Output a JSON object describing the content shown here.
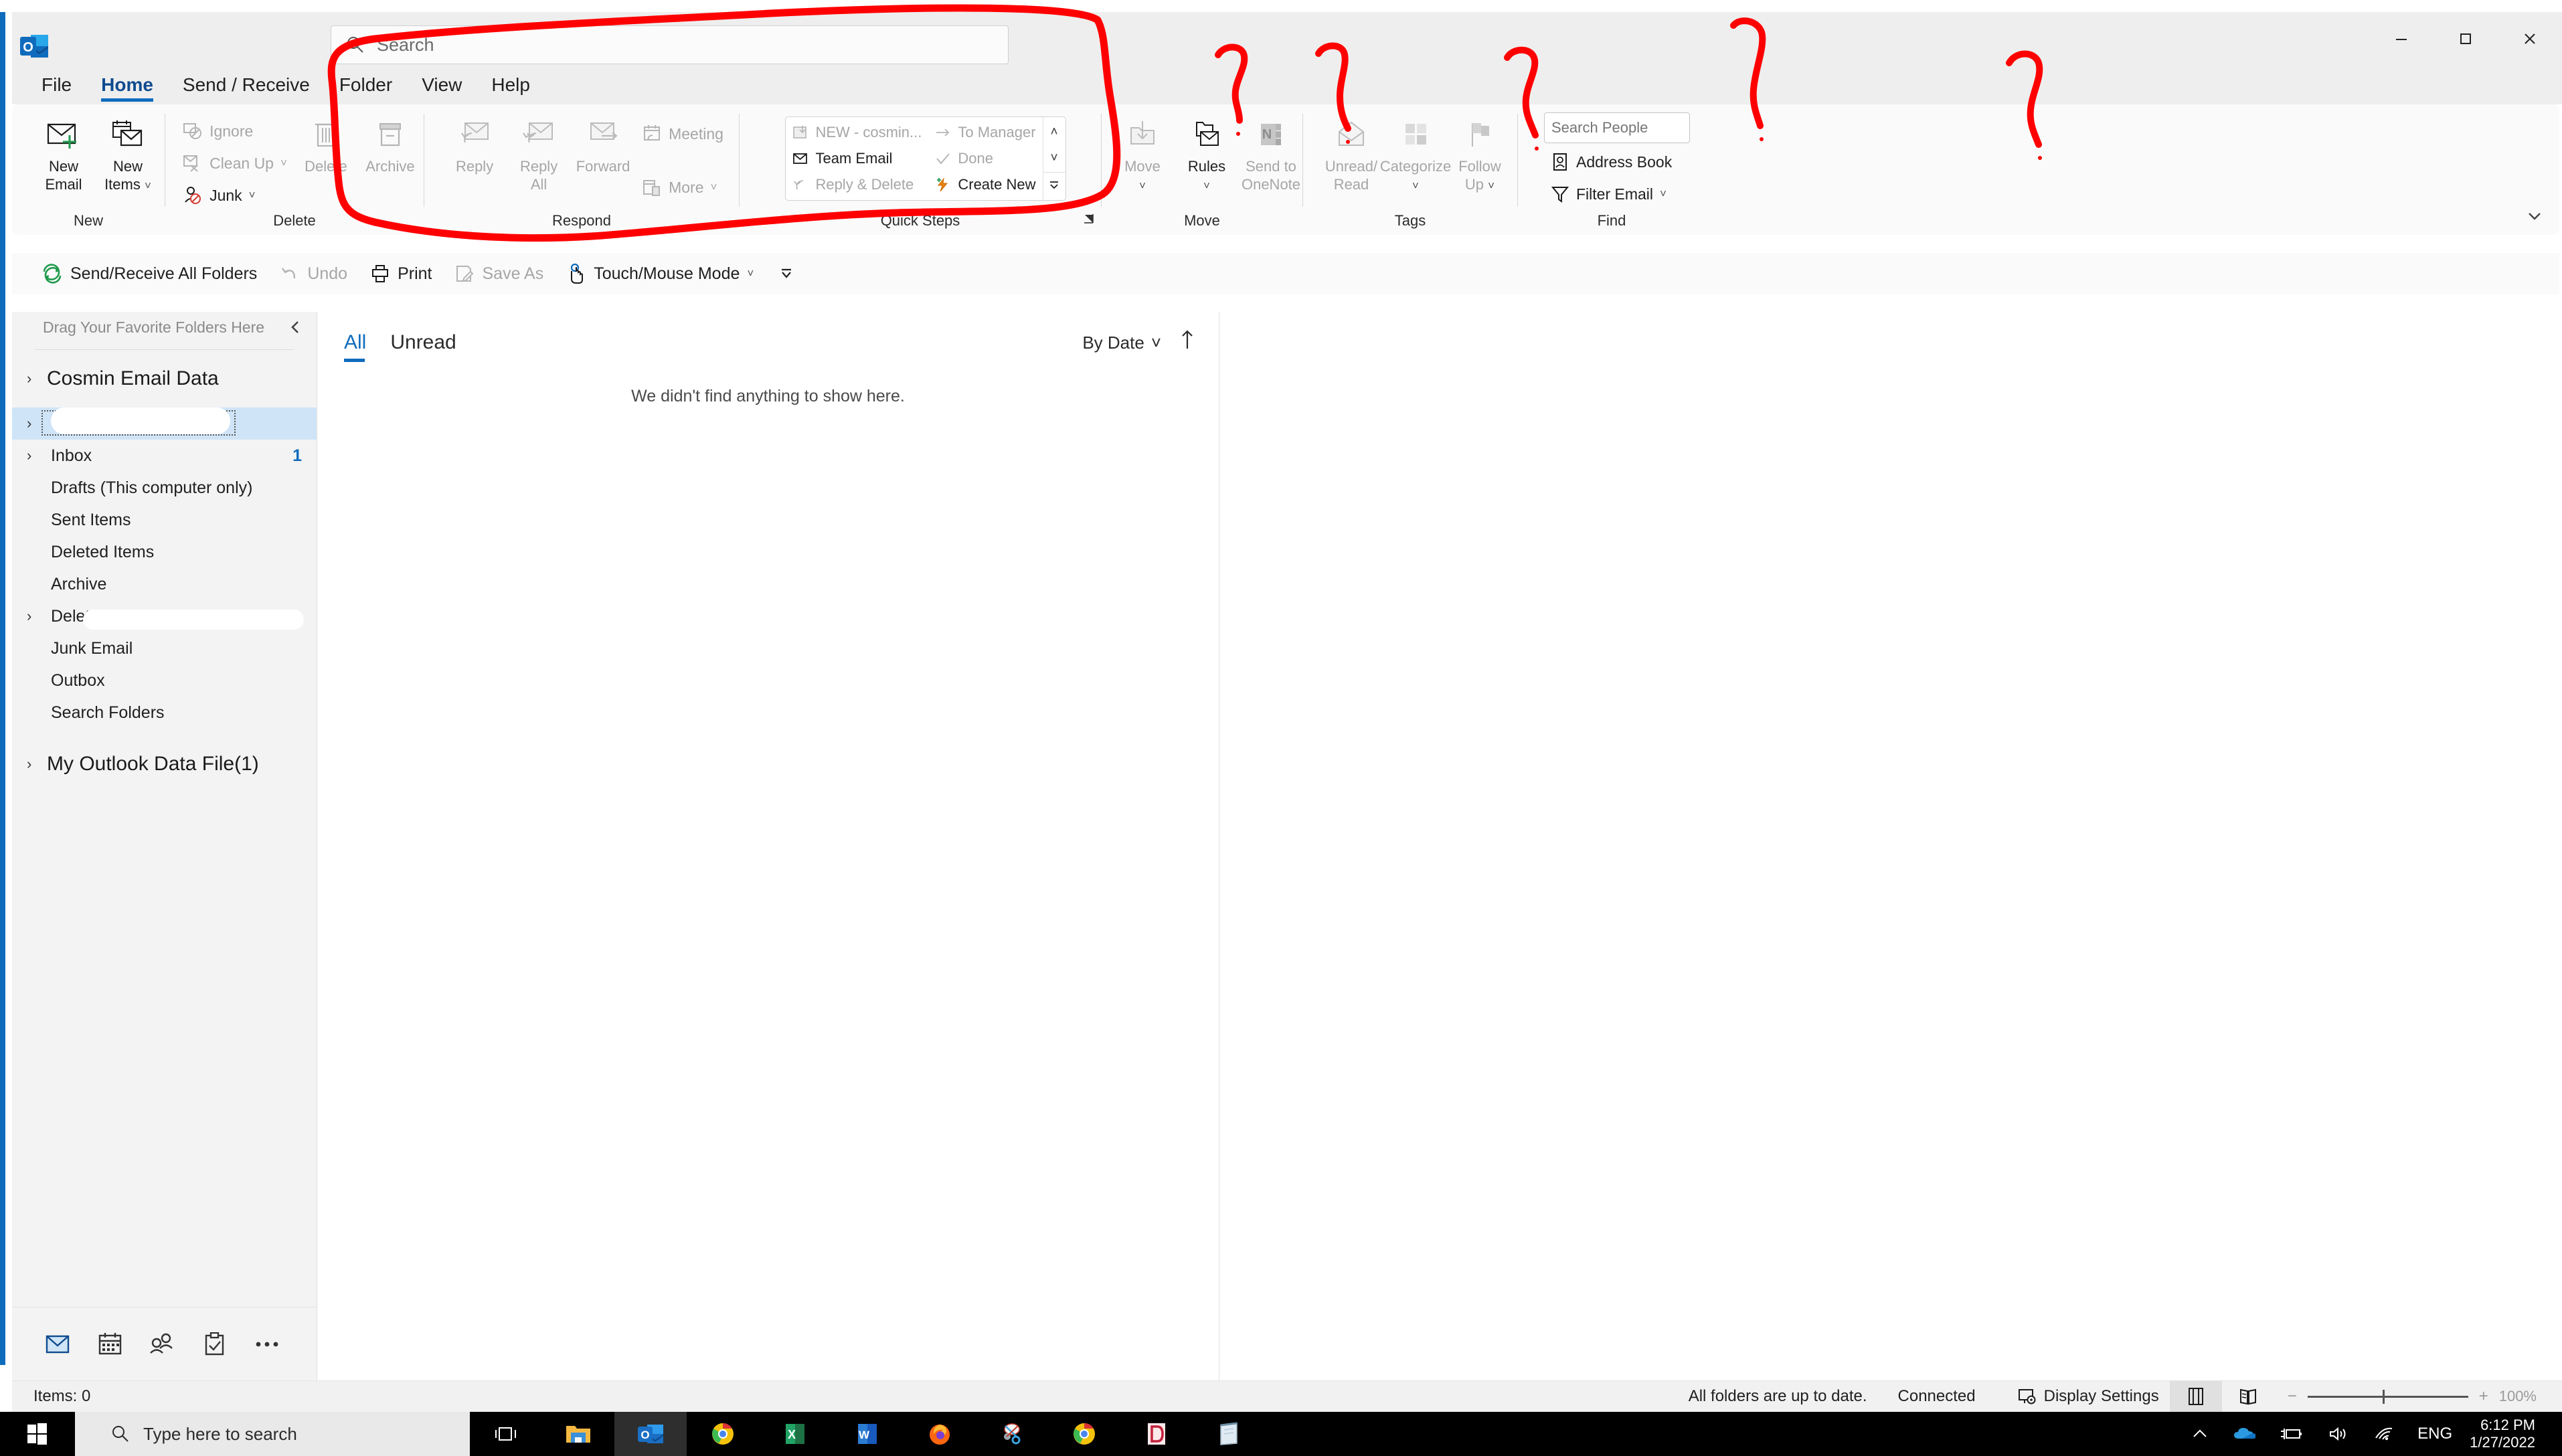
{
  "window": {
    "app_icon": "outlook-icon",
    "minimize": "—",
    "maximize": "□",
    "close": "✕"
  },
  "search": {
    "placeholder": "Search",
    "icon": "search-icon"
  },
  "tabs": [
    {
      "label": "File",
      "active": false
    },
    {
      "label": "Home",
      "active": true
    },
    {
      "label": "Send / Receive",
      "active": false
    },
    {
      "label": "Folder",
      "active": false
    },
    {
      "label": "View",
      "active": false
    },
    {
      "label": "Help",
      "active": false
    }
  ],
  "ribbon": {
    "collapse_icon": "chevron-down-icon",
    "groups": {
      "new": {
        "label": "New",
        "buttons": [
          {
            "label_line1": "New",
            "label_line2": "Email",
            "icon": "new-email-icon",
            "disabled": false
          },
          {
            "label_line1": "New",
            "label_line2": "Items",
            "icon": "new-items-icon",
            "disabled": false,
            "caret": "˅"
          }
        ]
      },
      "delete": {
        "label": "Delete",
        "small": [
          {
            "label": "Ignore",
            "icon": "ignore-icon",
            "disabled": true
          },
          {
            "label": "Clean Up",
            "icon": "cleanup-icon",
            "disabled": true,
            "caret": "˅"
          },
          {
            "label": "Junk",
            "icon": "junk-icon",
            "disabled": false,
            "caret": "˅"
          }
        ],
        "big": [
          {
            "label_line1": "Delete",
            "label_line2": "",
            "icon": "trash-icon",
            "disabled": true
          },
          {
            "label_line1": "Archive",
            "label_line2": "",
            "icon": "archive-icon",
            "disabled": true
          }
        ]
      },
      "respond": {
        "label": "Respond",
        "big": [
          {
            "label_line1": "Reply",
            "label_line2": "",
            "icon": "reply-icon",
            "disabled": true
          },
          {
            "label_line1": "Reply",
            "label_line2": "All",
            "icon": "reply-all-icon",
            "disabled": true
          },
          {
            "label_line1": "Forward",
            "label_line2": "",
            "icon": "forward-icon",
            "disabled": true
          }
        ],
        "small": [
          {
            "label": "Meeting",
            "icon": "meeting-icon",
            "disabled": true
          },
          {
            "label": "More",
            "icon": "more-icon",
            "disabled": true,
            "caret": "˅"
          }
        ]
      },
      "quick_steps": {
        "label": "Quick Steps",
        "dialog_launcher": "dialog-launcher-icon",
        "col1": [
          {
            "label": "NEW - cosmin...",
            "icon": "move-to-folder-icon",
            "disabled": true
          },
          {
            "label": "Team Email",
            "icon": "team-email-icon",
            "disabled": false
          },
          {
            "label": "Reply & Delete",
            "icon": "reply-delete-icon",
            "disabled": true
          }
        ],
        "col2": [
          {
            "label": "To Manager",
            "icon": "to-manager-icon",
            "disabled": true
          },
          {
            "label": "Done",
            "icon": "done-check-icon",
            "disabled": true
          },
          {
            "label": "Create New",
            "icon": "create-new-lightning-icon",
            "disabled": false
          }
        ],
        "scroll": [
          "˄",
          "˅",
          "˅"
        ]
      },
      "move": {
        "label": "Move",
        "buttons": [
          {
            "label_line1": "Move",
            "label_line2": "",
            "icon": "move-folder-icon",
            "disabled": true,
            "caret": "˅"
          },
          {
            "label_line1": "Rules",
            "label_line2": "",
            "icon": "rules-icon",
            "disabled": false,
            "caret": "˅"
          },
          {
            "label_line1": "Send to",
            "label_line2": "OneNote",
            "icon": "onenote-icon",
            "disabled": true
          }
        ]
      },
      "tags": {
        "label": "Tags",
        "buttons": [
          {
            "label_line1": "Unread/",
            "label_line2": "Read",
            "icon": "unread-read-icon",
            "disabled": true
          },
          {
            "label_line1": "Categorize",
            "label_line2": "",
            "icon": "categorize-icon",
            "disabled": true,
            "caret": "˅"
          },
          {
            "label_line1": "Follow",
            "label_line2": "Up",
            "icon": "follow-up-flag-icon",
            "disabled": true,
            "caret": "˅"
          }
        ]
      },
      "find": {
        "label": "Find",
        "people_placeholder": "Search People",
        "items": [
          {
            "label": "Address Book",
            "icon": "address-book-icon",
            "disabled": false
          },
          {
            "label": "Filter Email",
            "icon": "filter-funnel-icon",
            "disabled": false,
            "caret": "˅"
          }
        ]
      }
    }
  },
  "qat": [
    {
      "label": "Send/Receive All Folders",
      "icon": "send-receive-icon",
      "disabled": false
    },
    {
      "label": "Undo",
      "icon": "undo-icon",
      "disabled": true
    },
    {
      "label": "Print",
      "icon": "print-icon",
      "disabled": false
    },
    {
      "label": "Save As",
      "icon": "save-as-icon",
      "disabled": true
    },
    {
      "label": "Touch/Mouse Mode",
      "icon": "touch-mouse-icon",
      "disabled": false,
      "caret": "˅"
    },
    {
      "label": "",
      "icon": "qat-overflow-icon",
      "disabled": false
    }
  ],
  "navpane": {
    "favorites_hint": "Drag Your Favorite Folders Here",
    "collapse_icon": "chevron-left-icon",
    "roots": [
      {
        "label": "Cosmin Email Data",
        "arrow": "›"
      }
    ],
    "folders": [
      {
        "label": "",
        "arrow": "›",
        "selected": true,
        "redacted": true,
        "count": ""
      },
      {
        "label": "Inbox",
        "arrow": "›",
        "selected": false,
        "redacted": false,
        "count": "1"
      },
      {
        "label": "Drafts (This computer only)",
        "arrow": "",
        "selected": false,
        "redacted": false,
        "count": ""
      },
      {
        "label": "Sent Items",
        "arrow": "",
        "selected": false,
        "redacted": false,
        "count": ""
      },
      {
        "label": "Deleted Items",
        "arrow": "",
        "selected": false,
        "redacted": false,
        "count": ""
      },
      {
        "label": "Archive",
        "arrow": "",
        "selected": false,
        "redacted": false,
        "count": ""
      },
      {
        "label": "Deleted mail",
        "arrow": "›",
        "selected": false,
        "redacted": true,
        "count": ""
      },
      {
        "label": "Junk Email",
        "arrow": "",
        "selected": false,
        "redacted": false,
        "count": ""
      },
      {
        "label": "Outbox",
        "arrow": "",
        "selected": false,
        "redacted": false,
        "count": ""
      },
      {
        "label": "Search Folders",
        "arrow": "",
        "selected": false,
        "redacted": false,
        "count": ""
      }
    ],
    "roots2": [
      {
        "label": "My Outlook Data File(1)",
        "arrow": "›"
      }
    ],
    "modules": [
      {
        "name": "mail-icon",
        "active": true
      },
      {
        "name": "calendar-icon",
        "active": false
      },
      {
        "name": "people-icon",
        "active": false
      },
      {
        "name": "tasks-icon",
        "active": false
      },
      {
        "name": "more-modules-icon",
        "active": false
      }
    ]
  },
  "message_list": {
    "tabs": [
      {
        "label": "All",
        "active": true
      },
      {
        "label": "Unread",
        "active": false
      }
    ],
    "sort_label": "By Date",
    "sort_caret": "˅",
    "sort_direction_icon": "sort-ascending-arrow-icon",
    "empty_text": "We didn't find anything to show here."
  },
  "statusbar": {
    "items_count": "Items: 0",
    "sync_status": "All folders are up to date.",
    "connection": "Connected",
    "display_settings": "Display Settings",
    "display_settings_icon": "display-settings-icon",
    "view_normal_icon": "normal-view-icon",
    "view_reading_icon": "reading-view-icon",
    "zoom_minus": "−",
    "zoom_plus": "+",
    "zoom_level": "100%"
  },
  "taskbar": {
    "start_icon": "windows-start-icon",
    "search_placeholder": "Type here to search",
    "search_icon": "search-icon",
    "taskview_icon": "task-view-icon",
    "apps": [
      {
        "name": "file-explorer-icon",
        "active": false
      },
      {
        "name": "outlook-icon",
        "active": true
      },
      {
        "name": "chrome-icon",
        "active": false
      },
      {
        "name": "excel-icon",
        "active": false
      },
      {
        "name": "word-icon",
        "active": false
      },
      {
        "name": "firefox-icon",
        "active": false
      },
      {
        "name": "snipping-tool-icon",
        "active": false
      },
      {
        "name": "chrome-icon",
        "active": false
      },
      {
        "name": "dictionary-icon",
        "active": false
      },
      {
        "name": "notepad-icon",
        "active": false
      }
    ],
    "tray": [
      {
        "name": "show-hidden-icons-icon"
      },
      {
        "name": "onedrive-icon"
      },
      {
        "name": "battery-charging-icon"
      },
      {
        "name": "volume-icon"
      },
      {
        "name": "wifi-icon"
      }
    ],
    "language": "ENG",
    "time": "6:12 PM",
    "date": "1/27/2022"
  },
  "annotations": {
    "color": "#FF0000",
    "ellipse_target": "search-box",
    "question_mark_count": 5
  }
}
